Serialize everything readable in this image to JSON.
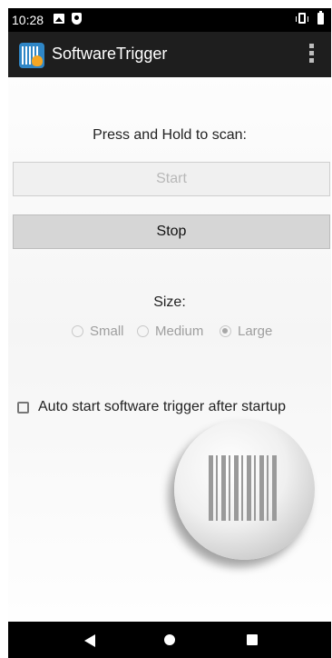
{
  "status_bar": {
    "time": "10:28"
  },
  "app_bar": {
    "title": "SoftwareTrigger"
  },
  "main": {
    "press_label": "Press and Hold to scan:",
    "start_label": "Start",
    "stop_label": "Stop",
    "size_label": "Size:",
    "size_options": [
      {
        "label": "Small",
        "selected": false
      },
      {
        "label": "Medium",
        "selected": false
      },
      {
        "label": "Large",
        "selected": true
      }
    ],
    "auto_start_label": "Auto start software trigger after startup"
  },
  "colors": {
    "app_bar": "#1e1e1e",
    "status_bar": "#000000",
    "nav_bar": "#000000"
  }
}
